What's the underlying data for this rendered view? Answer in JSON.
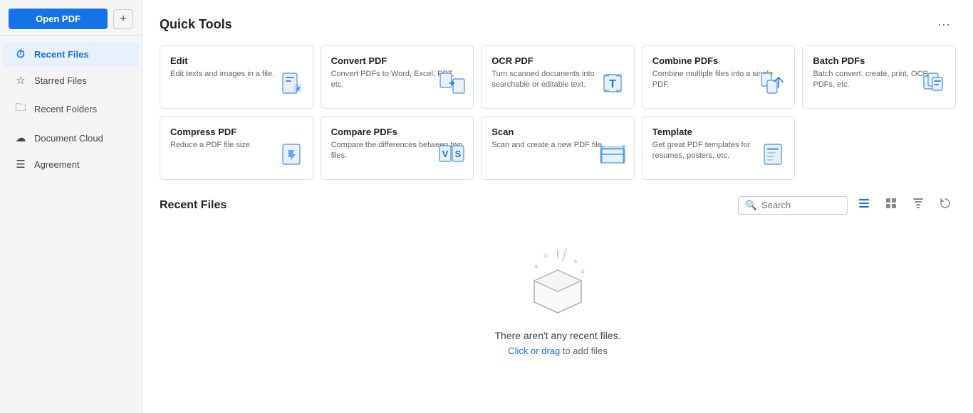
{
  "sidebar": {
    "open_pdf_label": "Open PDF",
    "add_label": "+",
    "nav_items": [
      {
        "id": "recent-files",
        "label": "Recent Files",
        "icon": "⏱",
        "active": true
      },
      {
        "id": "starred-files",
        "label": "Starred Files",
        "icon": "☆",
        "active": false
      },
      {
        "id": "recent-folders",
        "label": "Recent Folders",
        "icon": "🗁",
        "active": false
      },
      {
        "id": "document-cloud",
        "label": "Document Cloud",
        "icon": "☁",
        "active": false
      },
      {
        "id": "agreement",
        "label": "Agreement",
        "icon": "☰",
        "active": false
      }
    ]
  },
  "quick_tools": {
    "section_title": "Quick Tools",
    "more_icon": "•••",
    "tools": [
      {
        "id": "edit",
        "title": "Edit",
        "desc": "Edit texts and images in a file.",
        "icon": "edit"
      },
      {
        "id": "convert-pdf",
        "title": "Convert PDF",
        "desc": "Convert PDFs to Word, Excel, PPT, etc.",
        "icon": "convert"
      },
      {
        "id": "ocr-pdf",
        "title": "OCR PDF",
        "desc": "Turn scanned documents into searchable or editable text.",
        "icon": "ocr"
      },
      {
        "id": "combine-pdfs",
        "title": "Combine PDFs",
        "desc": "Combine multiple files into a single PDF.",
        "icon": "combine"
      },
      {
        "id": "batch-pdfs",
        "title": "Batch PDFs",
        "desc": "Batch convert, create, print, OCR PDFs, etc.",
        "icon": "batch"
      },
      {
        "id": "compress-pdf",
        "title": "Compress PDF",
        "desc": "Reduce a PDF file size.",
        "icon": "compress"
      },
      {
        "id": "compare-pdfs",
        "title": "Compare PDFs",
        "desc": "Compare the differences between two files.",
        "icon": "compare"
      },
      {
        "id": "scan",
        "title": "Scan",
        "desc": "Scan and create a new PDF file.",
        "icon": "scan"
      },
      {
        "id": "template",
        "title": "Template",
        "desc": "Get great PDF templates for resumes, posters, etc.",
        "icon": "template"
      }
    ]
  },
  "recent_files": {
    "section_title": "Recent Files",
    "search_placeholder": "Search",
    "empty_title": "There aren't any recent files.",
    "empty_link_text": "Click or drag",
    "empty_link_suffix": " to add files"
  }
}
